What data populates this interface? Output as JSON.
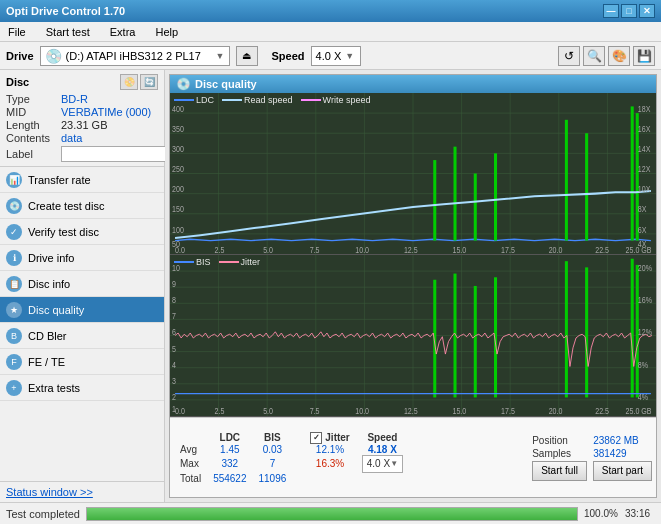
{
  "titleBar": {
    "title": "Opti Drive Control 1.70",
    "minimizeBtn": "—",
    "maximizeBtn": "□",
    "closeBtn": "✕"
  },
  "menuBar": {
    "items": [
      "File",
      "Start test",
      "Extra",
      "Help"
    ]
  },
  "driveBar": {
    "label": "Drive",
    "driveText": "(D:) ATAPI iHBS312  2 PL17",
    "speedLabel": "Speed",
    "speedValue": "4.0 X"
  },
  "disc": {
    "title": "Disc",
    "typeLabel": "Type",
    "typeValue": "BD-R",
    "midLabel": "MID",
    "midValue": "VERBATIMe (000)",
    "lengthLabel": "Length",
    "lengthValue": "23.31 GB",
    "contentsLabel": "Contents",
    "contentsValue": "data",
    "labelLabel": "Label"
  },
  "nav": {
    "items": [
      {
        "id": "transfer-rate",
        "label": "Transfer rate",
        "active": false
      },
      {
        "id": "create-test-disc",
        "label": "Create test disc",
        "active": false
      },
      {
        "id": "verify-test-disc",
        "label": "Verify test disc",
        "active": false
      },
      {
        "id": "drive-info",
        "label": "Drive info",
        "active": false
      },
      {
        "id": "disc-info",
        "label": "Disc info",
        "active": false
      },
      {
        "id": "disc-quality",
        "label": "Disc quality",
        "active": true
      },
      {
        "id": "cd-bler",
        "label": "CD Bler",
        "active": false
      },
      {
        "id": "fe-te",
        "label": "FE / TE",
        "active": false
      },
      {
        "id": "extra-tests",
        "label": "Extra tests",
        "active": false
      }
    ],
    "statusWindow": "Status window >>"
  },
  "discQuality": {
    "title": "Disc quality"
  },
  "charts": {
    "chart1": {
      "legendLDC": "LDC",
      "legendRead": "Read speed",
      "legendWrite": "Write speed",
      "yLabels": [
        "400",
        "350",
        "300",
        "250",
        "200",
        "150",
        "100",
        "50"
      ],
      "yLabelsRight": [
        "18X",
        "16X",
        "14X",
        "12X",
        "10X",
        "8X",
        "6X",
        "4X",
        "2X"
      ],
      "xLabels": [
        "0.0",
        "2.5",
        "5.0",
        "7.5",
        "10.0",
        "12.5",
        "15.0",
        "17.5",
        "20.0",
        "22.5",
        "25.0 GB"
      ]
    },
    "chart2": {
      "legendBIS": "BIS",
      "legendJitter": "Jitter",
      "yLabels": [
        "10",
        "9",
        "8",
        "7",
        "6",
        "5",
        "4",
        "3",
        "2",
        "1"
      ],
      "yLabelsRight": [
        "20%",
        "16%",
        "12%",
        "8%",
        "4%"
      ],
      "xLabels": [
        "0.0",
        "2.5",
        "5.0",
        "7.5",
        "10.0",
        "12.5",
        "15.0",
        "17.5",
        "20.0",
        "22.5",
        "25.0 GB"
      ]
    }
  },
  "stats": {
    "columns": [
      "LDC",
      "BIS",
      "",
      "Jitter",
      "Speed"
    ],
    "avgLabel": "Avg",
    "avgLDC": "1.45",
    "avgBIS": "0.03",
    "avgJitter": "12.1%",
    "maxLabel": "Max",
    "maxLDC": "332",
    "maxBIS": "7",
    "maxJitter": "16.3%",
    "totalLabel": "Total",
    "totalLDC": "554622",
    "totalBIS": "11096",
    "positionLabel": "Position",
    "positionValue": "23862 MB",
    "samplesLabel": "Samples",
    "samplesValue": "381429",
    "speedDisplay": "4.18 X",
    "speedBoxValue": "4.0 X",
    "startFullBtn": "Start full",
    "startPartBtn": "Start part"
  },
  "bottomBar": {
    "statusText": "Test completed",
    "progressPct": "100.0%",
    "timeValue": "33:16"
  }
}
